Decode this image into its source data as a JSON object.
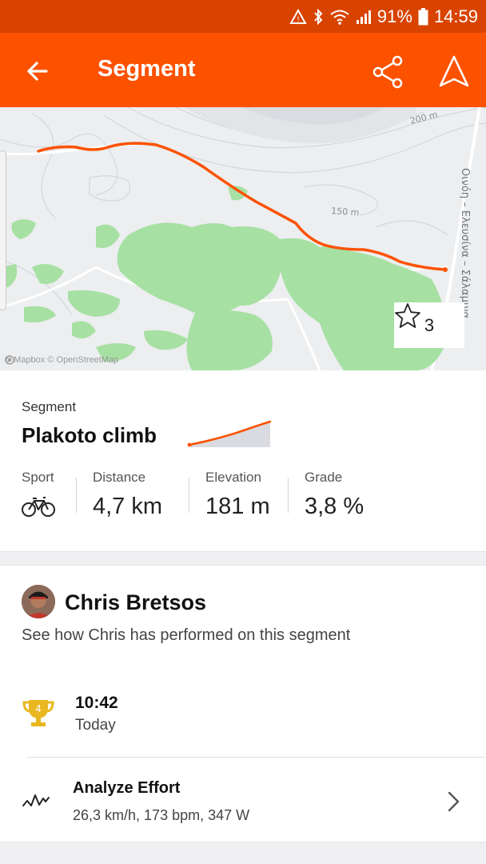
{
  "status_bar": {
    "battery": "91%",
    "time": "14:59"
  },
  "app_bar": {
    "title": "Segment"
  },
  "map": {
    "contour_labels": [
      "200 m",
      "150 m"
    ],
    "road_label": "Οινόη – Ελευσίνα – Σάλαμινα",
    "attribution": "© Mapbox © OpenStreetMap",
    "star_count": "3"
  },
  "segment": {
    "label": "Segment",
    "name": "Plakoto climb",
    "stats": [
      {
        "label": "Sport",
        "value": ""
      },
      {
        "label": "Distance",
        "value": "4,7 km"
      },
      {
        "label": "Elevation",
        "value": "181 m"
      },
      {
        "label": "Grade",
        "value": "3,8 %"
      }
    ]
  },
  "athlete": {
    "name": "Chris Bretsos",
    "subtitle": "See how Chris has performed on this segment",
    "rank": "4",
    "effort_time": "10:42",
    "effort_date": "Today",
    "analyze_title": "Analyze Effort",
    "analyze_sub": "26,3 km/h, 173 bpm, 347 W"
  },
  "colors": {
    "brand": "#fc5200",
    "status_bar": "#d84300",
    "trophy": "#e9b820"
  }
}
